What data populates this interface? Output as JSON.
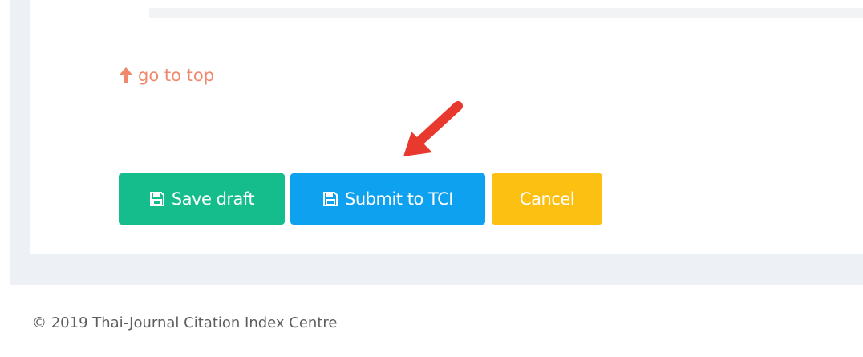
{
  "navigation": {
    "go_to_top_label": "go to top",
    "go_to_top_icon": "arrow-up-icon"
  },
  "actions": {
    "save_draft_label": "Save draft",
    "submit_label": "Submit to TCI",
    "cancel_label": "Cancel",
    "save_icon": "floppy-disk-icon",
    "submit_icon": "floppy-disk-icon"
  },
  "footer": {
    "copyright": "© 2019 Thai-Journal Citation Index Centre"
  },
  "colors": {
    "save_draft": "#16bd8c",
    "submit": "#0da1f0",
    "cancel": "#fbc012",
    "link": "#f0896c",
    "annotation_arrow": "#e8392f",
    "page_background": "#edf0f4"
  }
}
